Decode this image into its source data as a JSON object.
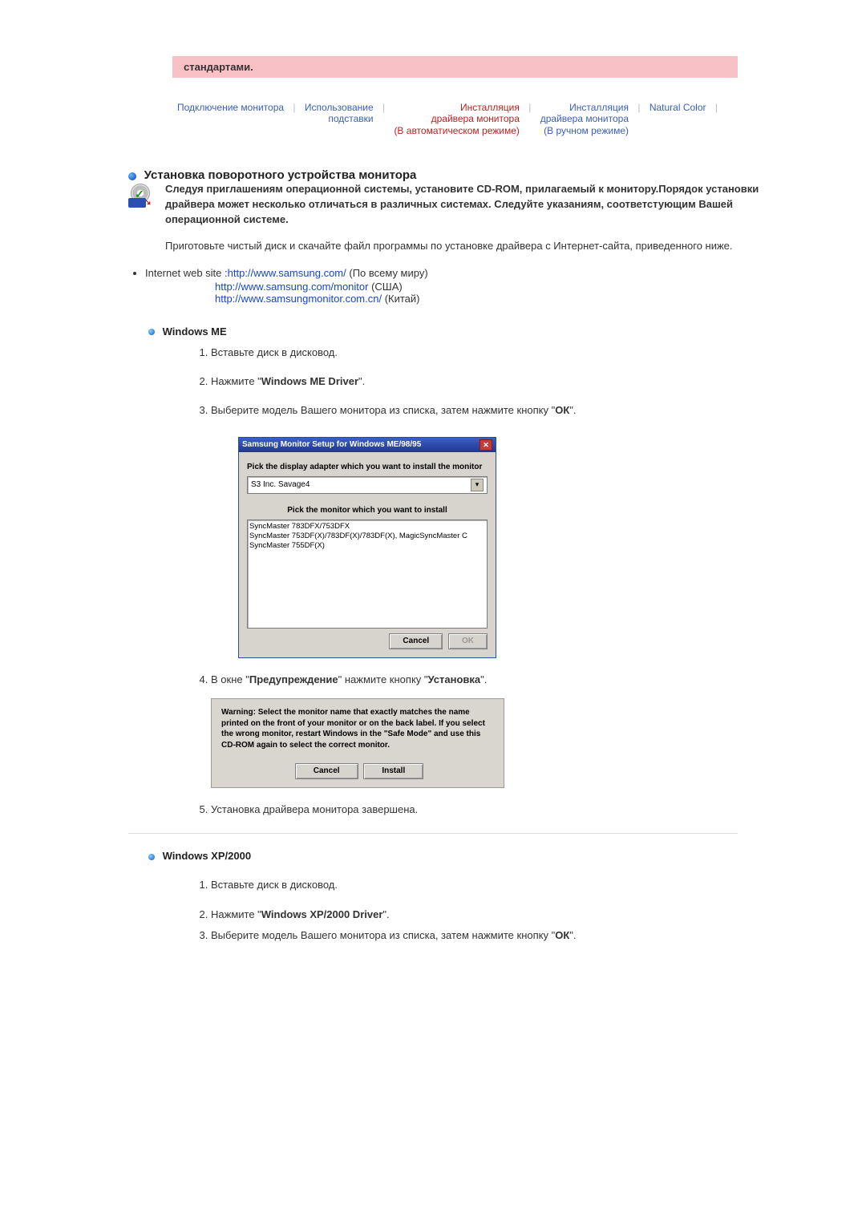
{
  "banner": "стандартами.",
  "nav": {
    "t1": "Подключение монитора",
    "t2_a": "Использование",
    "t2_b": "подставки",
    "t3_a": "Инсталляция",
    "t3_b": "драйвера монитора",
    "t3_c": "(В автоматическом режиме)",
    "t4_a": "Инсталляция",
    "t4_b": "драйвера монитора",
    "t4_c": "(В ручном режиме)",
    "t5": "Natural Color"
  },
  "section1_title": "Установка поворотного устройства монитора",
  "intro_bold": "Следуя приглашениям операционной системы, установите CD-ROM, прилагаемый к монитору.Порядок установки драйвера может несколько отличаться в различных системах. Следуйте указаниям, соответстующим Вашей операционной системе.",
  "intro_plain": "Приготовьте чистый диск и скачайте файл программы по установке драйвера с Интернет-сайта, приведенного ниже.",
  "bullet_label": "Internet web site :",
  "url1": "http://www.samsung.com/",
  "url1_tail": " (По всему миру)",
  "url2": "http://www.samsung.com/monitor",
  "url2_tail": " (США)",
  "url3": "http://www.samsungmonitor.com.cn/",
  "url3_tail": " (Китай)",
  "me_heading": "Windows ME",
  "me_steps": {
    "s1": "Вставьте диск в дисковод.",
    "s2_a": "Нажмите \"",
    "s2_b": "Windows ME Driver",
    "s2_c": "\".",
    "s3_a": "Выберите модель Вашего монитора из списка, затем нажмите кнопку \"",
    "s3_b": "ОК",
    "s3_c": "\".",
    "s4_a": "В окне \"",
    "s4_b": "Предупреждение",
    "s4_c": "\" нажмите кнопку \"",
    "s4_d": "Установка",
    "s4_e": "\".",
    "s5": "Установка драйвера монитора завершена."
  },
  "win1": {
    "title": "Samsung Monitor Setup for Windows ME/98/95",
    "label1": "Pick the display adapter which you want to install the monitor",
    "combo_value": "S3 Inc. Savage4",
    "label2": "Pick the monitor which you want to install",
    "list": [
      "SyncMaster 783DFX/753DFX",
      "SyncMaster 753DF(X)/783DF(X)/783DF(X), MagicSyncMaster C",
      "SyncMaster 755DF(X)"
    ],
    "btn_cancel": "Cancel",
    "btn_ok": "OK"
  },
  "dlg": {
    "text": "Warning: Select the monitor name that exactly matches the name printed on the front of your monitor or on the back label. If you select the wrong monitor, restart Windows in the \"Safe Mode\" and use this CD-ROM again to select the correct monitor.",
    "btn_cancel": "Cancel",
    "btn_install": "Install"
  },
  "xp_heading": "Windows XP/2000",
  "xp_steps": {
    "s1": "Вставьте диск в дисковод.",
    "s2_a": "Нажмите \"",
    "s2_b": "Windows XP/2000 Driver",
    "s2_c": "\".",
    "s3_a": "Выберите модель Вашего монитора из списка, затем нажмите кнопку \"",
    "s3_b": "ОК",
    "s3_c": "\"."
  }
}
